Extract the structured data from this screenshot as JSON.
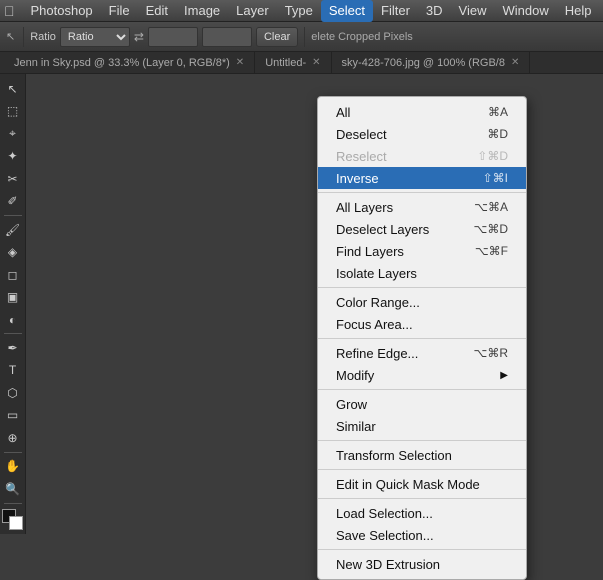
{
  "app": {
    "name": "Photoshop",
    "apple_symbol": ""
  },
  "menubar": {
    "items": [
      {
        "label": "Photoshop",
        "id": "photoshop"
      },
      {
        "label": "File",
        "id": "file"
      },
      {
        "label": "Edit",
        "id": "edit"
      },
      {
        "label": "Image",
        "id": "image"
      },
      {
        "label": "Layer",
        "id": "layer"
      },
      {
        "label": "Type",
        "id": "type"
      },
      {
        "label": "Select",
        "id": "select",
        "active": true
      },
      {
        "label": "Filter",
        "id": "filter"
      },
      {
        "label": "3D",
        "id": "3d"
      },
      {
        "label": "View",
        "id": "view"
      },
      {
        "label": "Window",
        "id": "window"
      },
      {
        "label": "Help",
        "id": "help"
      }
    ]
  },
  "toolbar": {
    "ratio_label": "Ratio",
    "clear_button": "Clear",
    "delete_cropped_label": "elete Cropped Pixels"
  },
  "tabs": [
    {
      "label": "Jenn in Sky.psd @ 33.3% (Layer 0, RGB/8*)",
      "active": false
    },
    {
      "label": "Untitled-",
      "active": false
    },
    {
      "label": "sky-428-706.jpg @ 100% (RGB/8",
      "active": false
    }
  ],
  "select_menu": {
    "items": [
      {
        "label": "All",
        "shortcut": "⌘A",
        "id": "all",
        "type": "item"
      },
      {
        "label": "Deselect",
        "shortcut": "⌘D",
        "id": "deselect",
        "type": "item"
      },
      {
        "label": "Reselect",
        "shortcut": "⇧⌘D",
        "id": "reselect",
        "type": "item",
        "disabled": true
      },
      {
        "label": "Inverse",
        "shortcut": "⇧⌘I",
        "id": "inverse",
        "type": "item",
        "highlighted": true
      },
      {
        "type": "separator"
      },
      {
        "label": "All Layers",
        "shortcut": "⌥⌘A",
        "id": "all-layers",
        "type": "item"
      },
      {
        "label": "Deselect Layers",
        "shortcut": "⌥⌘D",
        "id": "deselect-layers",
        "type": "item"
      },
      {
        "label": "Find Layers",
        "shortcut": "⌥⌘F",
        "id": "find-layers",
        "type": "item"
      },
      {
        "label": "Isolate Layers",
        "id": "isolate-layers",
        "type": "item"
      },
      {
        "type": "separator"
      },
      {
        "label": "Color Range...",
        "id": "color-range",
        "type": "item"
      },
      {
        "label": "Focus Area...",
        "id": "focus-area",
        "type": "item"
      },
      {
        "type": "separator"
      },
      {
        "label": "Refine Edge...",
        "shortcut": "⌥⌘R",
        "id": "refine-edge",
        "type": "item"
      },
      {
        "label": "Modify",
        "id": "modify",
        "type": "item",
        "arrow": true
      },
      {
        "type": "separator"
      },
      {
        "label": "Grow",
        "id": "grow",
        "type": "item"
      },
      {
        "label": "Similar",
        "id": "similar",
        "type": "item"
      },
      {
        "type": "separator"
      },
      {
        "label": "Transform Selection",
        "id": "transform-selection",
        "type": "item"
      },
      {
        "type": "separator"
      },
      {
        "label": "Edit in Quick Mask Mode",
        "id": "quick-mask",
        "type": "item"
      },
      {
        "type": "separator"
      },
      {
        "label": "Load Selection...",
        "id": "load-selection",
        "type": "item"
      },
      {
        "label": "Save Selection...",
        "id": "save-selection",
        "type": "item"
      },
      {
        "type": "separator"
      },
      {
        "label": "New 3D Extrusion",
        "id": "new-3d-extrusion",
        "type": "item"
      }
    ]
  },
  "tools": [
    "↖",
    "✂",
    "⬡",
    "⌖",
    "✏",
    "🖌",
    "✐",
    "◈",
    "✂",
    "⊕",
    "🔍",
    "⌨",
    "▣",
    "⟳",
    "◐",
    "⬜",
    "🖊",
    "✂",
    "◯",
    "🔧"
  ]
}
